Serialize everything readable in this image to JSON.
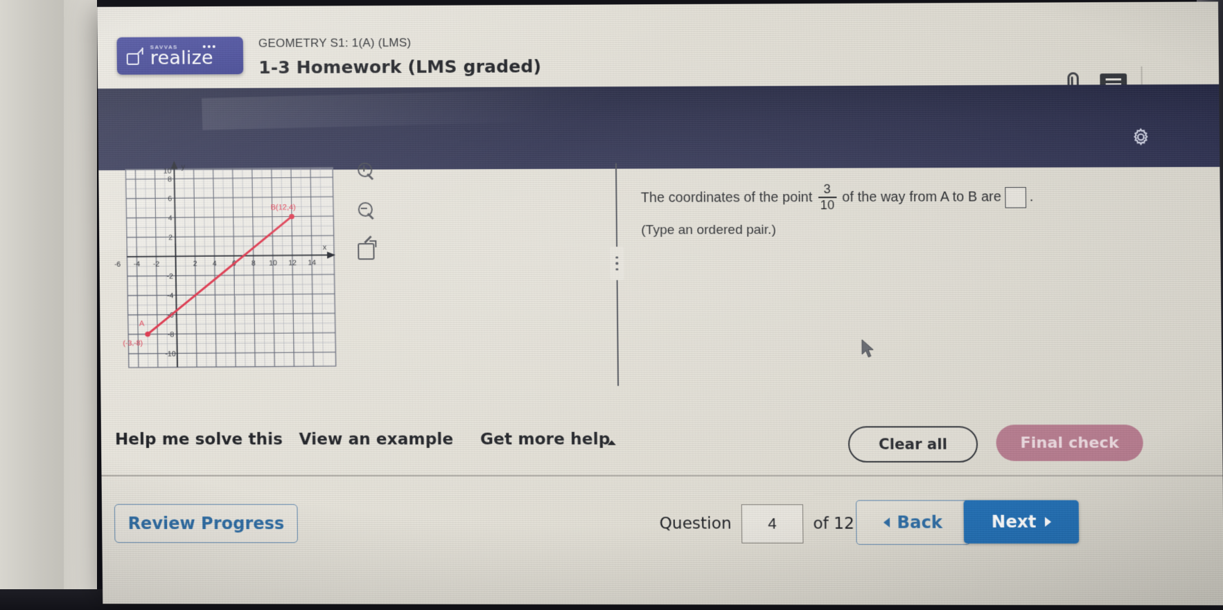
{
  "header": {
    "logo_sub": "SAVVAS",
    "logo_text": "realize",
    "course": "GEOMETRY S1: 1(A) (LMS)",
    "assignment": "1-3 Homework (LMS graded)",
    "icons": {
      "attachment": "paperclip-icon",
      "messages": "chat-icon",
      "settings": "gear-icon"
    }
  },
  "question": {
    "text_before_fraction": "The coordinates of the point",
    "fraction_numerator": "3",
    "fraction_denominator": "10",
    "text_after_fraction": "of the way from A to B are",
    "answer_value": "",
    "period": ".",
    "instruction": "(Type an ordered pair.)"
  },
  "graph_tools": [
    {
      "name": "zoom-in-tool",
      "label": "Zoom in"
    },
    {
      "name": "zoom-out-tool",
      "label": "Zoom out"
    },
    {
      "name": "expand-graph-tool",
      "label": "Expand"
    }
  ],
  "help": {
    "solve": "Help me solve this",
    "example": "View an example",
    "more": "Get more help",
    "clear_all": "Clear all",
    "final_check": "Final check"
  },
  "footer": {
    "review_progress": "Review Progress",
    "question_label": "Question",
    "question_number": "4",
    "of_label": "of 12",
    "back": "Back",
    "next": "Next"
  },
  "colors": {
    "brand_navy": "#32368a",
    "band_navy": "#272a48",
    "link_blue": "#2b6ba3",
    "next_blue": "#1f6eb4",
    "final_check_rose": "#b4798c",
    "plot_red": "#e0334a"
  },
  "chart_data": {
    "type": "scatter",
    "title": "",
    "xlabel": "x",
    "ylabel": "y",
    "xlim": [
      -6,
      15
    ],
    "ylim": [
      -11,
      11
    ],
    "xticks": [
      -6,
      -4,
      -2,
      2,
      4,
      6,
      8,
      10,
      12,
      14
    ],
    "xtick_labels": [
      "-6",
      "-4",
      "-2",
      "2",
      "4",
      "6",
      "8",
      "10",
      "12",
      "14"
    ],
    "yticks": [
      -10,
      -8,
      -6,
      -4,
      -2,
      2,
      4,
      6,
      8,
      10
    ],
    "ytick_labels": [
      "-10",
      "-8",
      "-6",
      "-4",
      "-2",
      "2",
      "4",
      "6",
      "8",
      "10"
    ],
    "grid": true,
    "points": [
      {
        "label": "A",
        "annotation": "A(-3,-8)",
        "x": -3,
        "y": -8,
        "color": "#e0334a"
      },
      {
        "label": "B",
        "annotation": "B(12,4)",
        "x": 12,
        "y": 4,
        "color": "#e0334a"
      }
    ],
    "segments": [
      {
        "from": [
          -3,
          -8
        ],
        "to": [
          12,
          4
        ],
        "color": "#e0334a",
        "width": 3
      }
    ]
  }
}
